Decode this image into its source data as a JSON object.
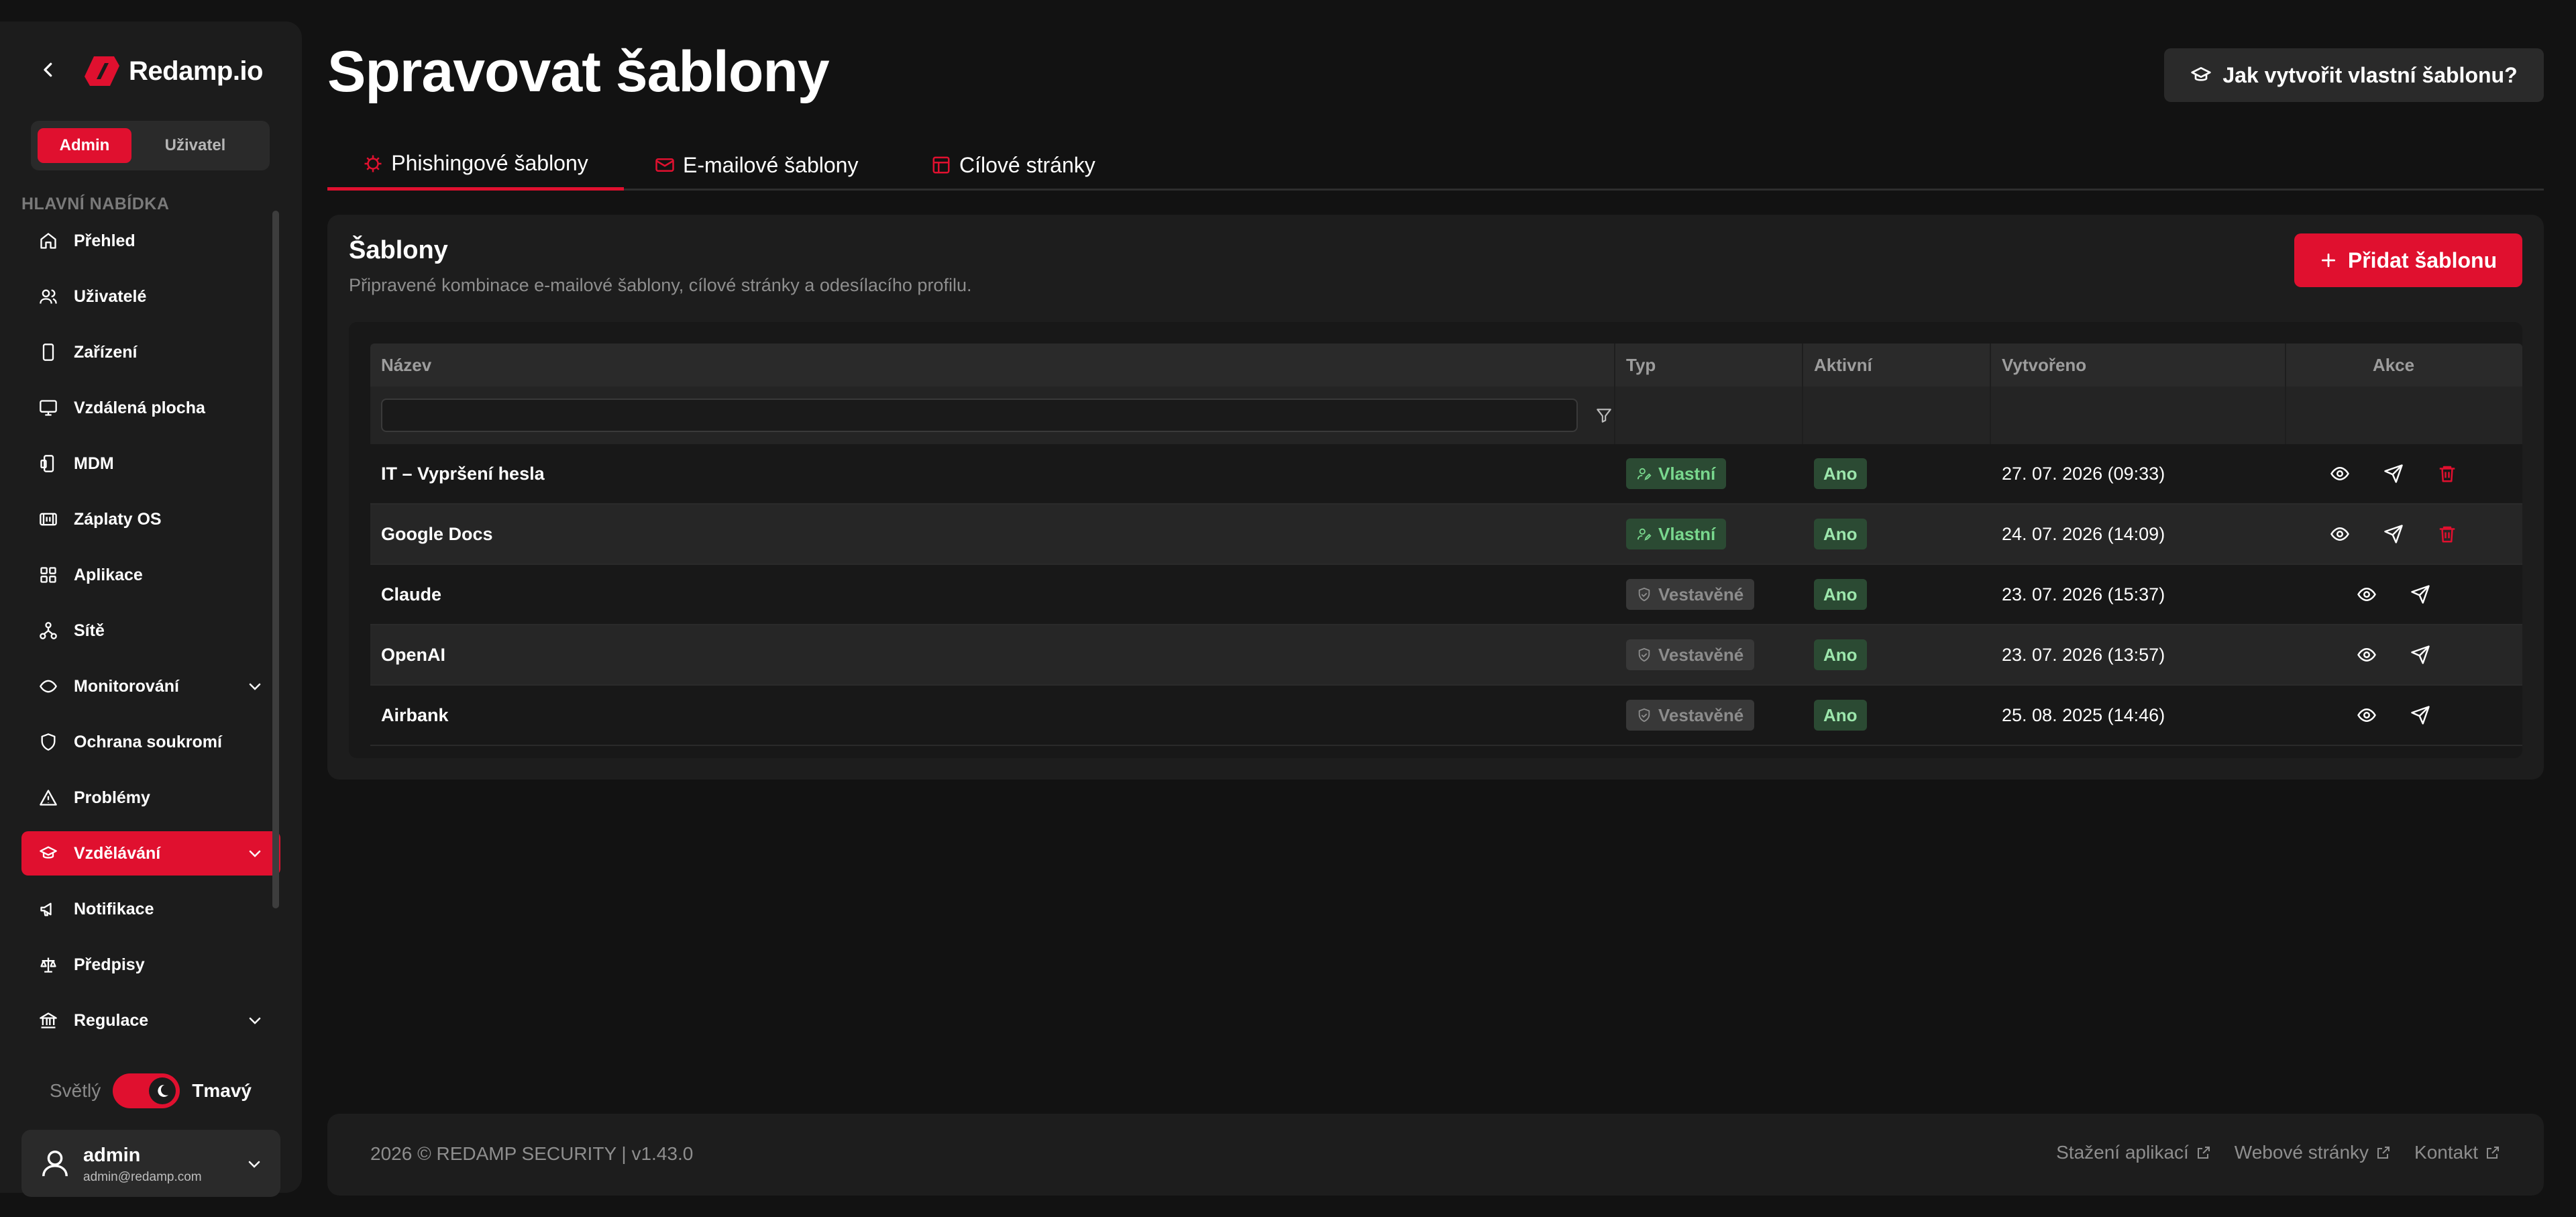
{
  "brand": {
    "name": "Redamp.io",
    "accent": "#e0102f"
  },
  "sidebar": {
    "roles": {
      "admin": "Admin",
      "user": "Uživatel"
    },
    "heading": "HLAVNÍ NABÍDKA",
    "items": [
      {
        "label": "Přehled",
        "icon": "home-icon"
      },
      {
        "label": "Uživatelé",
        "icon": "users-icon"
      },
      {
        "label": "Zařízení",
        "icon": "device-icon"
      },
      {
        "label": "Vzdálená plocha",
        "icon": "monitor-icon"
      },
      {
        "label": "MDM",
        "icon": "mdm-icon"
      },
      {
        "label": "Záplaty OS",
        "icon": "patch-icon"
      },
      {
        "label": "Aplikace",
        "icon": "apps-icon"
      },
      {
        "label": "Sítě",
        "icon": "network-icon"
      },
      {
        "label": "Monitorování",
        "icon": "monitoring-icon"
      },
      {
        "label": "Ochrana soukromí",
        "icon": "shield-icon"
      },
      {
        "label": "Problémy",
        "icon": "warning-icon"
      },
      {
        "label": "Vzdělávání",
        "icon": "education-icon"
      },
      {
        "label": "Notifikace",
        "icon": "megaphone-icon"
      },
      {
        "label": "Předpisy",
        "icon": "scale-icon"
      },
      {
        "label": "Regulace",
        "icon": "regulation-icon"
      }
    ],
    "theme": {
      "light": "Světlý",
      "dark": "Tmavý"
    },
    "user": {
      "name": "admin",
      "email": "admin@redamp.com"
    }
  },
  "page": {
    "title": "Spravovat šablony",
    "help_button": "Jak vytvořit vlastní šablonu?"
  },
  "tabs": [
    {
      "label": "Phishingové šablony",
      "icon": "phishing-icon"
    },
    {
      "label": "E-mailové šablony",
      "icon": "mail-icon"
    },
    {
      "label": "Cílové stránky",
      "icon": "landing-page-icon"
    }
  ],
  "panel": {
    "title": "Šablony",
    "subtitle": "Připravené kombinace e-mailové šablony, cílové stránky a odesílacího profilu.",
    "add_button": "Přidat šablonu"
  },
  "table": {
    "columns": {
      "name": "Název",
      "type": "Typ",
      "active": "Aktivní",
      "created": "Vytvořeno",
      "actions": "Akce"
    },
    "filter_value": "",
    "rows": [
      {
        "name": "IT – Vypršení hesla",
        "type": "Vlastní",
        "active": "Ano",
        "created": "27. 07. 2026 (09:33)"
      },
      {
        "name": "Google Docs",
        "type": "Vlastní",
        "active": "Ano",
        "created": "24. 07. 2026 (14:09)"
      },
      {
        "name": "Claude",
        "type": "Vestavěné",
        "active": "Ano",
        "created": "23. 07. 2026 (15:37)"
      },
      {
        "name": "OpenAI",
        "type": "Vestavěné",
        "active": "Ano",
        "created": "23. 07. 2026 (13:57)"
      },
      {
        "name": "Airbank",
        "type": "Vestavěné",
        "active": "Ano",
        "created": "25. 08. 2025 (14:46)"
      }
    ]
  },
  "footer": {
    "copyright": "2026 © REDAMP SECURITY | v1.43.0",
    "links": [
      "Stažení aplikací",
      "Webové stránky",
      "Kontakt"
    ]
  }
}
